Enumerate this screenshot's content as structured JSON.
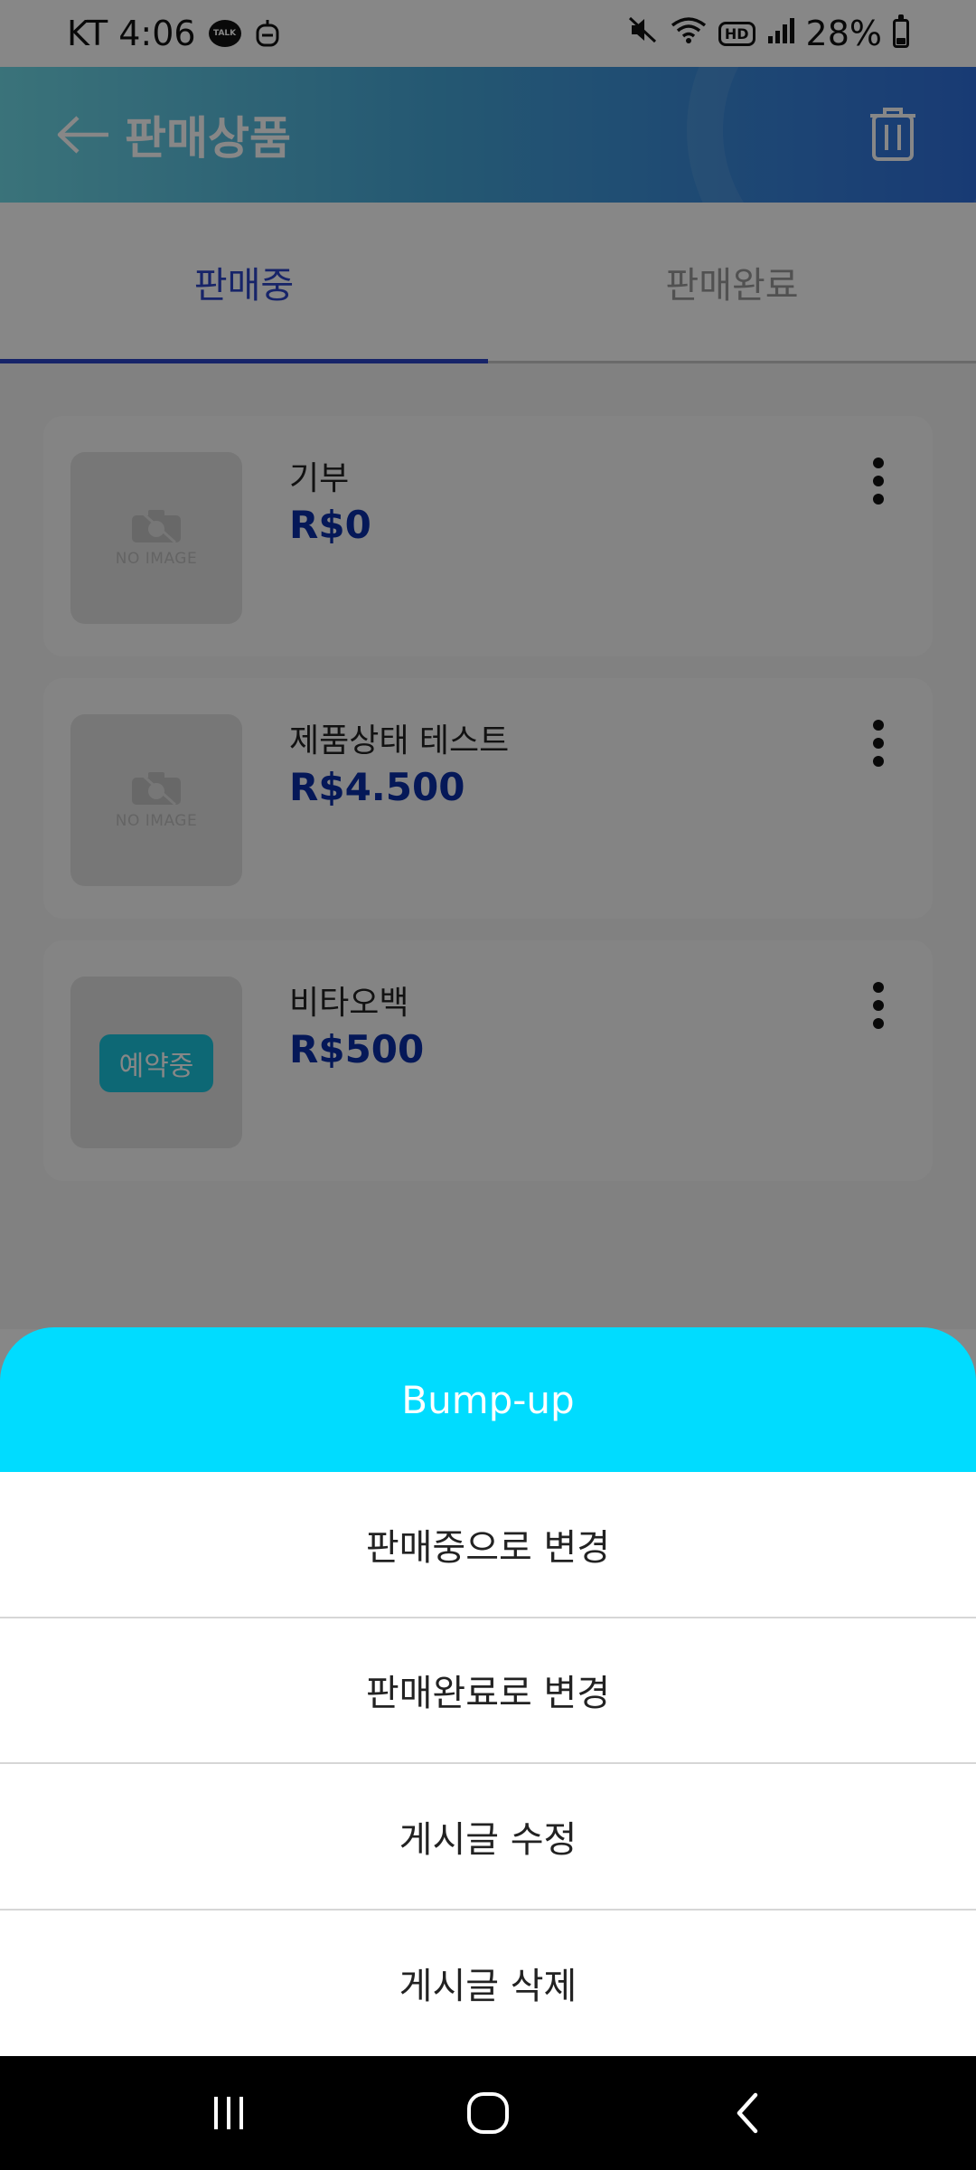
{
  "status_bar": {
    "carrier_time": "KT 4:06",
    "talk_badge": "TALK",
    "hd_badge": "HD",
    "battery": "28%",
    "battery_level": 0.28,
    "icons": [
      "talk-icon",
      "robot-icon",
      "mute-icon",
      "wifi-icon",
      "hd-icon",
      "signal-icon",
      "battery-icon"
    ]
  },
  "app_bar": {
    "title": "판매상품",
    "back_icon": "back-arrow-icon",
    "trash_icon": "trash-icon"
  },
  "tabs": [
    {
      "label": "판매중",
      "active": true
    },
    {
      "label": "판매완료",
      "active": false
    }
  ],
  "items": [
    {
      "name": "기부",
      "price": "R$0",
      "image_text": "NO IMAGE",
      "badge": ""
    },
    {
      "name": "제품상태 테스트",
      "price": "R$4.500",
      "image_text": "NO IMAGE",
      "badge": ""
    },
    {
      "name": "비타오백",
      "price": "R$500",
      "image_text": "",
      "badge": "예약중"
    }
  ],
  "sheet": {
    "header": "Bump-up",
    "options": [
      "판매중으로 변경",
      "판매완료로 변경",
      "게시글 수정",
      "게시글 삭제"
    ]
  },
  "colors": {
    "accent_blue": "#2c45c7",
    "price_blue": "#0a2ea6",
    "sheet_header": "#00dcff",
    "badge": "#19c5dd"
  }
}
